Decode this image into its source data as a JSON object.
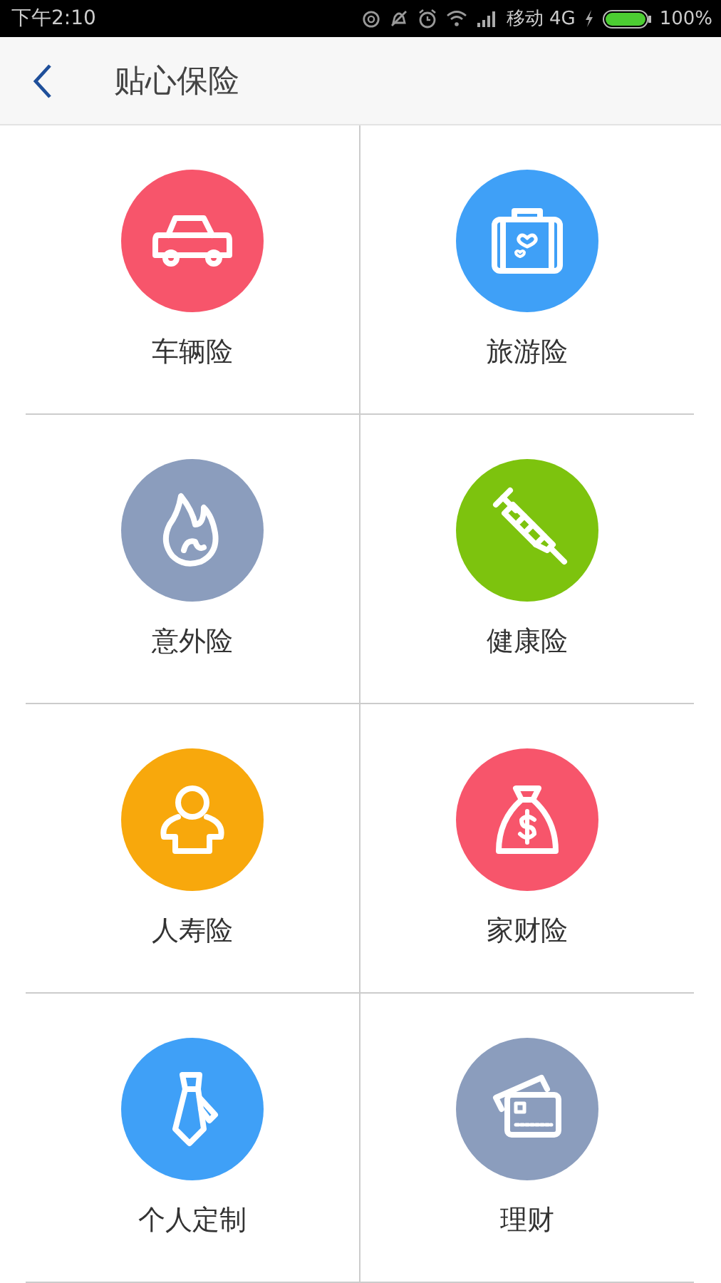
{
  "status_bar": {
    "time": "下午2:10",
    "carrier": "移动 4G",
    "battery": "100%"
  },
  "header": {
    "title": "贴心保险"
  },
  "items": [
    {
      "label": "车辆险",
      "kind": "car",
      "color": "#f7556b"
    },
    {
      "label": "旅游险",
      "kind": "suitcase",
      "color": "#3fa0f7"
    },
    {
      "label": "意外险",
      "kind": "flame",
      "color": "#8b9dbd"
    },
    {
      "label": "健康险",
      "kind": "syringe",
      "color": "#7dc30e"
    },
    {
      "label": "人寿险",
      "kind": "person",
      "color": "#f8a80c"
    },
    {
      "label": "家财险",
      "kind": "moneybag",
      "color": "#f7556b"
    },
    {
      "label": "个人定制",
      "kind": "tie",
      "color": "#3fa0f7"
    },
    {
      "label": "理财",
      "kind": "cards",
      "color": "#8b9dbd"
    }
  ]
}
